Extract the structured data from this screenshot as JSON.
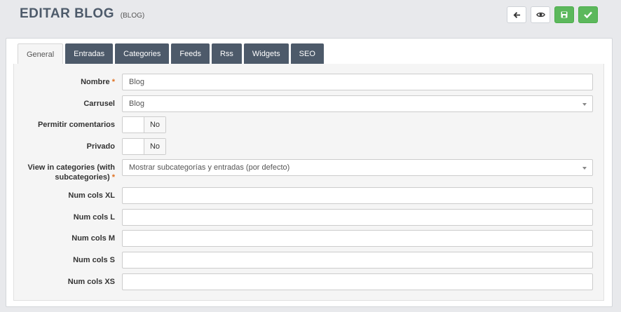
{
  "header": {
    "title": "EDITAR BLOG",
    "subtitle": "(BLOG)"
  },
  "actions": [
    {
      "name": "back-button",
      "icon": "arrow-left-icon"
    },
    {
      "name": "preview-button",
      "icon": "eye-icon"
    },
    {
      "name": "save-button",
      "icon": "floppy-disk-icon"
    },
    {
      "name": "save-close-button",
      "icon": "check-icon"
    }
  ],
  "tabs": [
    {
      "label": "General",
      "active": true
    },
    {
      "label": "Entradas"
    },
    {
      "label": "Categories"
    },
    {
      "label": "Feeds"
    },
    {
      "label": "Rss"
    },
    {
      "label": "Widgets"
    },
    {
      "label": "SEO"
    }
  ],
  "form": {
    "nombre": {
      "label": "Nombre",
      "required": "*",
      "value": "Blog"
    },
    "carrusel": {
      "label": "Carrusel",
      "value": "Blog"
    },
    "comentarios": {
      "label": "Permitir comentarios",
      "value": "No"
    },
    "privado": {
      "label": "Privado",
      "value": "No"
    },
    "view_in_categories": {
      "label_line1": "View in categories (with",
      "label_line2": "subcategories)",
      "required": "*",
      "value": "Mostrar subcategorías y entradas (por defecto)"
    },
    "cols_xl": {
      "label": "Num cols XL",
      "value": ""
    },
    "cols_l": {
      "label": "Num cols L",
      "value": ""
    },
    "cols_m": {
      "label": "Num cols M",
      "value": ""
    },
    "cols_s": {
      "label": "Num cols S",
      "value": ""
    },
    "cols_xs": {
      "label": "Num cols XS",
      "value": ""
    }
  },
  "colors": {
    "accent": "#4d5a6a",
    "success": "#5cb85c",
    "required": "#e07020"
  }
}
